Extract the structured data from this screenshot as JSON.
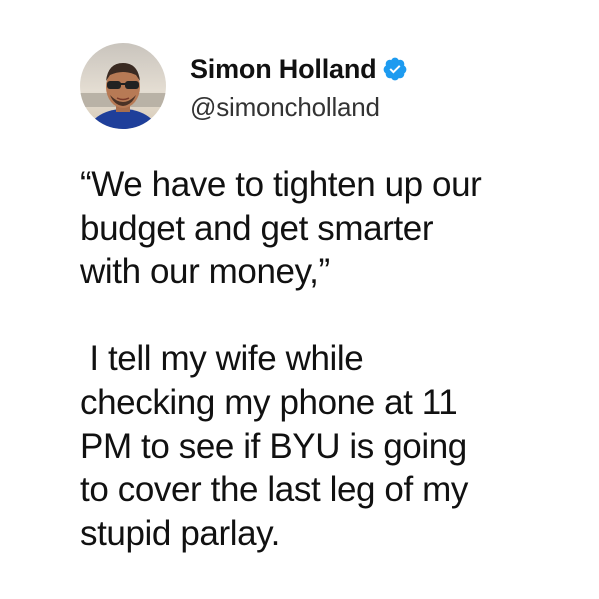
{
  "author": {
    "name": "Simon Holland",
    "handle": "@simoncholland",
    "verified_icon": "verified-badge-icon",
    "avatar_icon": "profile-photo"
  },
  "tweet": {
    "paragraph_1": [
      "“We have to tighten up our",
      "budget and get smarter",
      "with our money,”"
    ],
    "paragraph_2": [
      " I tell my wife while",
      "checking my phone at 11",
      "PM to see if BYU is going",
      "to cover the last leg of my",
      "stupid parlay."
    ]
  },
  "colors": {
    "background": "#ffffff",
    "text": "#111111",
    "handle": "#333333",
    "verified": "#1d9bf0"
  }
}
